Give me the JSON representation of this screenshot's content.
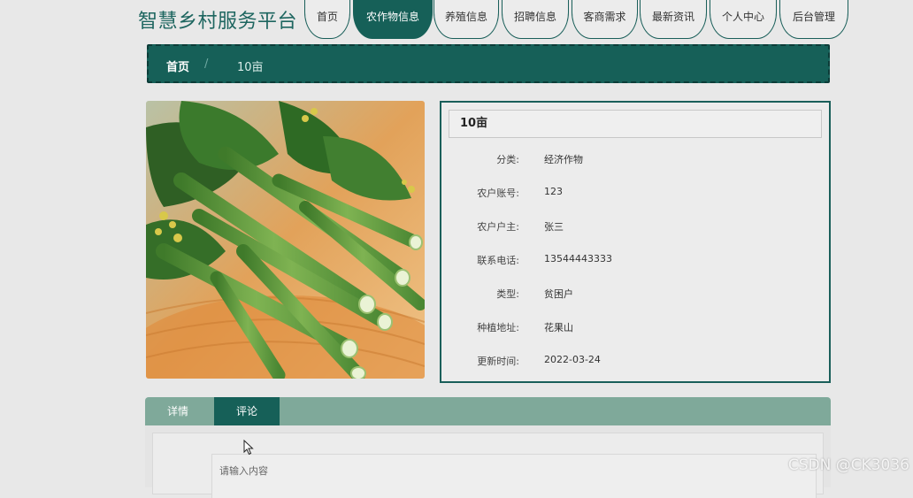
{
  "site": {
    "title": "智慧乡村服务平台"
  },
  "nav": {
    "items": [
      {
        "label": "首页"
      },
      {
        "label": "农作物信息",
        "active": true
      },
      {
        "label": "养殖信息"
      },
      {
        "label": "招聘信息"
      },
      {
        "label": "客商需求"
      },
      {
        "label": "最新资讯"
      },
      {
        "label": "个人中心"
      },
      {
        "label": "后台管理"
      }
    ]
  },
  "breadcrumb": {
    "home": "首页",
    "separator": "/",
    "current": "10亩"
  },
  "detail": {
    "title": "10亩",
    "fields": [
      {
        "label": "分类:",
        "value": "经济作物"
      },
      {
        "label": "农户账号:",
        "value": "123"
      },
      {
        "label": "农户户主:",
        "value": "张三"
      },
      {
        "label": "联系电话:",
        "value": "13544443333"
      },
      {
        "label": "类型:",
        "value": "贫困户"
      },
      {
        "label": "种植地址:",
        "value": "花果山"
      },
      {
        "label": "更新时间:",
        "value": "2022-03-24"
      }
    ]
  },
  "tabs": {
    "items": [
      {
        "label": "详情"
      },
      {
        "label": "评论",
        "active": true
      }
    ]
  },
  "comment": {
    "placeholder": "请输入内容"
  },
  "watermark": "CSDN @CK3036",
  "colors": {
    "primary": "#166058",
    "tab_bar": "#7fa99a",
    "background": "#e8e8e8"
  }
}
